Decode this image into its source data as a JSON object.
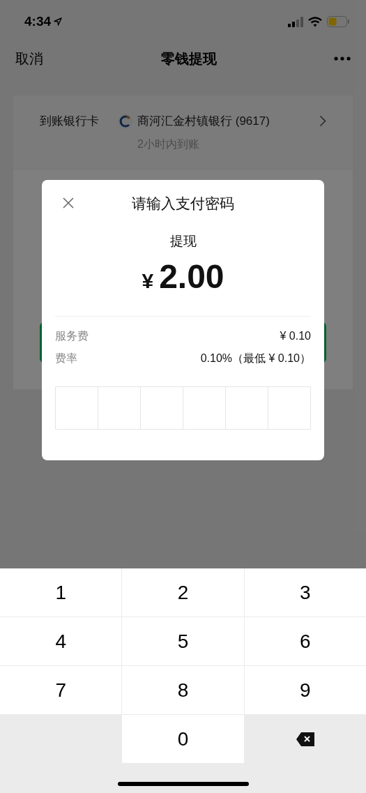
{
  "status_bar": {
    "time": "4:34"
  },
  "nav": {
    "cancel": "取消",
    "title": "零钱提现"
  },
  "bank_card": {
    "label": "到账银行卡",
    "bank_name": "商河汇金村镇银行 (9617)",
    "arrival_note": "2小时内到账"
  },
  "dialog": {
    "title": "请输入支付密码",
    "subtitle": "提现",
    "currency": "¥",
    "amount": "2.00",
    "fees": [
      {
        "label": "服务费",
        "value": "¥ 0.10"
      },
      {
        "label": "费率",
        "value": "0.10%（最低 ¥ 0.10）"
      }
    ],
    "pin_boxes": [
      {
        "filled": false
      },
      {
        "filled": false
      },
      {
        "filled": false
      },
      {
        "filled": false
      },
      {
        "filled": false
      },
      {
        "filled": false
      }
    ]
  },
  "keypad": [
    {
      "kind": "digit",
      "label": "1"
    },
    {
      "kind": "digit",
      "label": "2"
    },
    {
      "kind": "digit",
      "label": "3"
    },
    {
      "kind": "digit",
      "label": "4"
    },
    {
      "kind": "digit",
      "label": "5"
    },
    {
      "kind": "digit",
      "label": "6"
    },
    {
      "kind": "digit",
      "label": "7"
    },
    {
      "kind": "digit",
      "label": "8"
    },
    {
      "kind": "digit",
      "label": "9"
    },
    {
      "kind": "blank"
    },
    {
      "kind": "digit",
      "label": "0"
    },
    {
      "kind": "backspace"
    }
  ]
}
